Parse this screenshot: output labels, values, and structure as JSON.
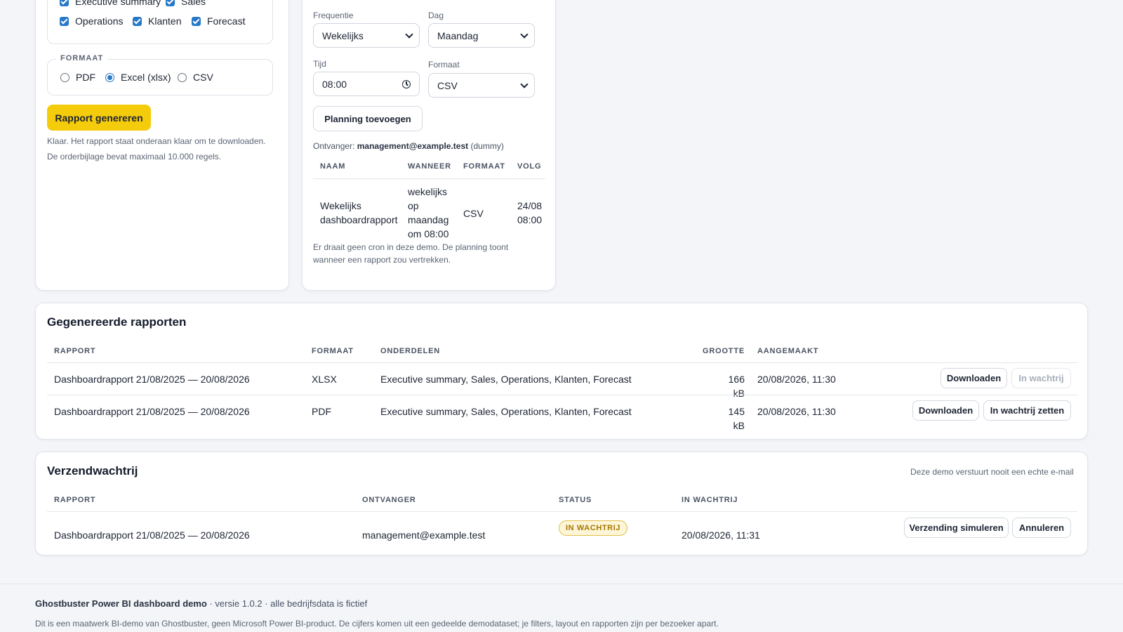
{
  "export": {
    "sections": [
      {
        "label": "Executive summary",
        "checked": true
      },
      {
        "label": "Sales",
        "checked": true
      },
      {
        "label": "Operations",
        "checked": true
      },
      {
        "label": "Klanten",
        "checked": true
      },
      {
        "label": "Forecast",
        "checked": true
      }
    ],
    "format_legend": "FORMAAT",
    "formats": [
      {
        "label": "PDF",
        "selected": false
      },
      {
        "label": "Excel (xlsx)",
        "selected": true
      },
      {
        "label": "CSV",
        "selected": false
      }
    ],
    "generate_label": "Rapport genereren",
    "status_line1": "Klaar. Het rapport staat onderaan klaar om te downloaden.",
    "status_line2": "De orderbijlage bevat maximaal 10.000 regels."
  },
  "schedule": {
    "frequency_label": "Frequentie",
    "frequency_value": "Wekelijks",
    "day_label": "Dag",
    "day_value": "Maandag",
    "time_label": "Tijd",
    "time_value": "08:00",
    "format_label": "Formaat",
    "format_value": "CSV",
    "add_label": "Planning toevoegen",
    "recipient_prefix": "Ontvanger:",
    "recipient_email": "management@example.test",
    "recipient_suffix": "(dummy)",
    "columns": [
      "NAAM",
      "WANNEER",
      "FORMAAT",
      "VOLG"
    ],
    "rows": [
      {
        "name_line1": "Wekelijks",
        "name_line2": "dashboardrapport",
        "when_lines": [
          "wekelijks",
          "op",
          "maandag",
          "om 08:00"
        ],
        "format": "CSV",
        "next_line1": "24/08",
        "next_line2": "08:00"
      }
    ],
    "note_line1": "Er draait geen cron in deze demo. De planning toont",
    "note_line2": "wanneer een rapport zou vertrekken."
  },
  "reports": {
    "title": "Gegenereerde rapporten",
    "columns": [
      "RAPPORT",
      "FORMAAT",
      "ONDERDELEN",
      "GROOTTE",
      "AANGEMAAKT"
    ],
    "rows": [
      {
        "name": "Dashboardrapport 21/08/2025 — 20/08/2026",
        "format": "XLSX",
        "sections": "Executive summary, Sales, Operations, Klanten, Forecast",
        "size": "166 kB",
        "created": "20/08/2026, 11:30",
        "download_label": "Downloaden",
        "queue_label": "In wachtrij",
        "queue_enabled": false
      },
      {
        "name": "Dashboardrapport 21/08/2025 — 20/08/2026",
        "format": "PDF",
        "sections": "Executive summary, Sales, Operations, Klanten, Forecast",
        "size": "145 kB",
        "created": "20/08/2026, 11:30",
        "download_label": "Downloaden",
        "queue_label": "In wachtrij zetten",
        "queue_enabled": true
      }
    ]
  },
  "queue": {
    "title": "Verzendwachtrij",
    "note": "Deze demo verstuurt nooit een echte e-mail",
    "columns": [
      "RAPPORT",
      "ONTVANGER",
      "STATUS",
      "IN WACHTRIJ"
    ],
    "rows": [
      {
        "name": "Dashboardrapport 21/08/2025 — 20/08/2026",
        "recipient": "management@example.test",
        "status": "IN WACHTRIJ",
        "queued_at": "20/08/2026, 11:31",
        "simulate_label": "Verzending simuleren",
        "cancel_label": "Annuleren"
      }
    ]
  },
  "footer": {
    "brand": "Ghostbuster Power BI dashboard demo",
    "meta": " · versie 1.0.2 · alle bedrijfsdata is fictief",
    "disclaimer": "Dit is een maatwerk BI-demo van Ghostbuster, geen Microsoft Power BI-product. De cijfers komen uit een gedeelde demodataset; je filters, layout en rapporten zijn per bezoeker apart."
  },
  "colors": {
    "accent": "#2878c8",
    "primary_button": "#f5cc0b",
    "badge_bg": "#fdf5d7",
    "badge_text": "#a57700"
  }
}
